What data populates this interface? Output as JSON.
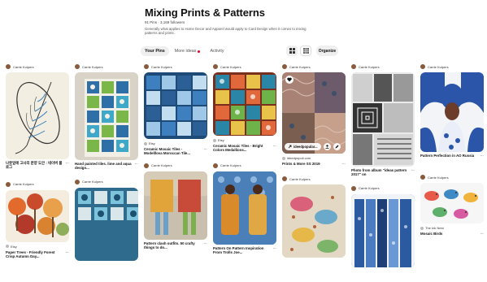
{
  "board": {
    "title": "Mixing Prints & Patterns",
    "stats": "91 Pins · 3,169 followers",
    "description": "Generally what applies to Home Decor and Apparel would apply to Card Design when it comes to mixing patterns and prints."
  },
  "tabs": [
    {
      "label": "Your Pins"
    },
    {
      "label": "More ideas"
    },
    {
      "label": "Activity"
    }
  ],
  "toolbar": {
    "organize_label": "Organize"
  },
  "author": "Carrie Kulpers",
  "pins": {
    "c1a": {
      "title": "나뭇잎에 고사리 문양 도안 : 네이버 블로그"
    },
    "c1b": {
      "source": "Etsy",
      "title": "Paper Trees - Friendly Forest Crisp Autumn Day..."
    },
    "c2a": {
      "title": "Hand painted tiles. lime and aqua design..."
    },
    "c3a": {
      "source": "Etsy",
      "title": "Ceramic Mosaic Tiles - Modelllova Moroccan Tile..."
    },
    "c3b": {
      "title": "Pattern clash outfits. 50 crafty things to do..."
    },
    "c4a": {
      "source": "Etsy",
      "title": "Ceramic Mosaic Tiles - Bright Colors Medallions..."
    },
    "c4b": {
      "title": "Pattern On Pattern Inspiration From Trolls Joe..."
    },
    "c5a": {
      "source": "ideedpopuli.com",
      "title": "Prints & More SS 2019",
      "overlay_link": "ideedpopular..."
    },
    "c6a": {
      "title": "Photo from album \"ideas pattern 2017\" on"
    },
    "c7a": {
      "title": "Pattern Perfection in AO Russia"
    },
    "c7b": {
      "source": "The Ink Nest",
      "title": "Mosaic Birds"
    }
  },
  "colors": {
    "accent": "#e60023",
    "chip_bg": "#efefef"
  }
}
